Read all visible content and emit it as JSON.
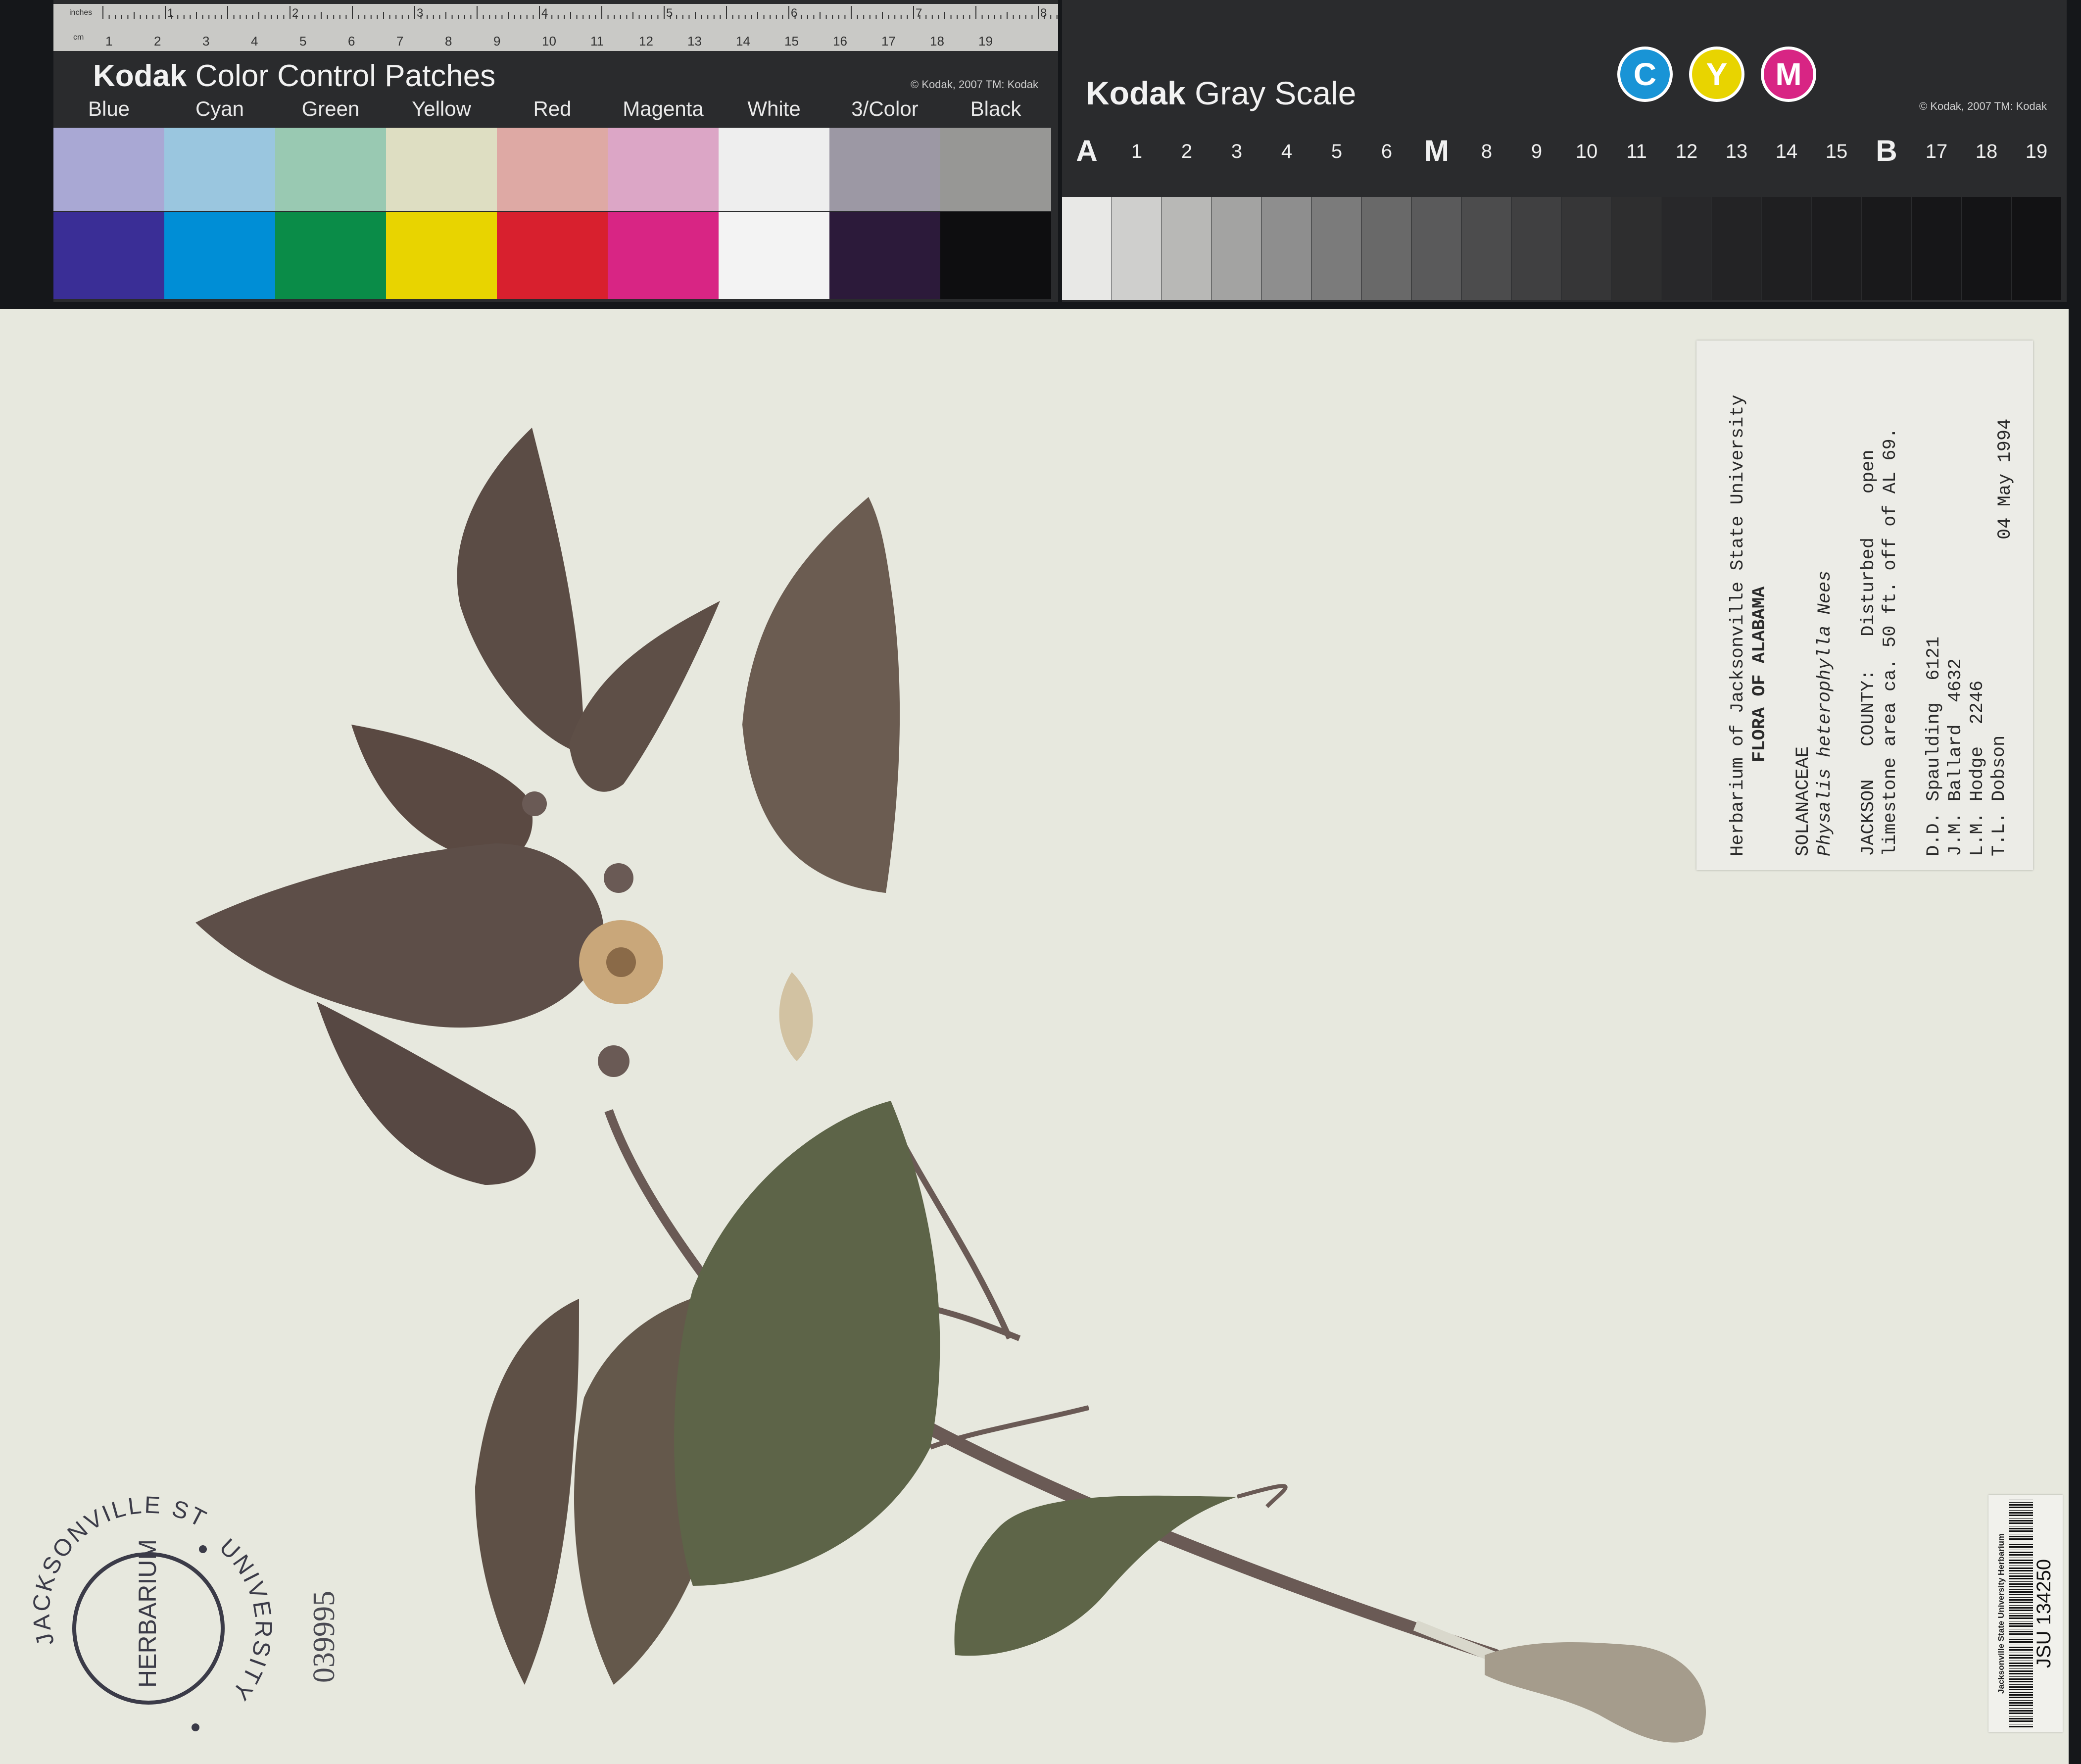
{
  "color_card": {
    "brand": "Kodak",
    "title": "Color Control Patches",
    "copyright": "© Kodak, 2007  TM: Kodak",
    "ruler_units": {
      "inches": "inches",
      "cm": "cm"
    },
    "inch_marks": [
      "1",
      "2",
      "3",
      "4",
      "5",
      "6",
      "7",
      "8"
    ],
    "cm_marks": [
      "1",
      "2",
      "3",
      "4",
      "5",
      "6",
      "7",
      "8",
      "9",
      "10",
      "11",
      "12",
      "13",
      "14",
      "15",
      "16",
      "17",
      "18",
      "19"
    ],
    "patches": [
      {
        "label": "Blue",
        "top": "#a9a8d4",
        "bottom": "#3a2e96"
      },
      {
        "label": "Cyan",
        "top": "#9ac6df",
        "bottom": "#008ed6"
      },
      {
        "label": "Green",
        "top": "#99c9b2",
        "bottom": "#0a8c48"
      },
      {
        "label": "Yellow",
        "top": "#dedec2",
        "bottom": "#e8d400"
      },
      {
        "label": "Red",
        "top": "#dea9a4",
        "bottom": "#d8202e"
      },
      {
        "label": "Magenta",
        "top": "#dca6c6",
        "bottom": "#d82584"
      },
      {
        "label": "White",
        "top": "#eeeeee",
        "bottom": "#f3f3f3"
      },
      {
        "label": "3/Color",
        "top": "#9c98a4",
        "bottom": "#2c1a3a"
      },
      {
        "label": "Black",
        "top": "#979795",
        "bottom": "#0e0e10"
      }
    ]
  },
  "gray_card": {
    "brand": "Kodak",
    "title": "Gray Scale",
    "copyright": "© Kodak, 2007  TM: Kodak",
    "cym": [
      {
        "letter": "C",
        "color": "#1994d6"
      },
      {
        "letter": "Y",
        "color": "#e8d400"
      },
      {
        "letter": "M",
        "color": "#d82584"
      }
    ],
    "steps": [
      "A",
      "1",
      "2",
      "3",
      "4",
      "5",
      "6",
      "M",
      "8",
      "9",
      "10",
      "11",
      "12",
      "13",
      "14",
      "15",
      "B",
      "17",
      "18",
      "19"
    ],
    "grays": [
      "#e8e8e6",
      "#cfcfcd",
      "#b8b8b6",
      "#a3a3a2",
      "#8e8e8e",
      "#7b7b7b",
      "#696969",
      "#5a5a5b",
      "#4c4c4d",
      "#404041",
      "#363637",
      "#2e2e2f",
      "#28282a",
      "#232325",
      "#1f1f21",
      "#1c1c1e",
      "#19191b",
      "#161618",
      "#141416",
      "#121214"
    ]
  },
  "specimen_label": {
    "herbarium": "Herbarium of Jacksonville State University",
    "flora": "FLORA OF ALABAMA",
    "family": "SOLANACEAE",
    "species": "Physalis heterophylla Nees",
    "locality_1": "JACKSON   COUNTY:   Disturbed    open",
    "locality_2": "limestone area ca. 50 ft. off of AL 69.",
    "collector_1": "D.D. Spaulding  6121",
    "collector_2": "J.M. Ballard  4632",
    "collector_3": "L.M. Hodge  2246",
    "collector_4": "T.L. Dobson",
    "date": "04 May 1994"
  },
  "stamp": {
    "top_text": "JACKSONVILLE STATE",
    "right_text": "UNIVERSITY",
    "center_text": "HERBARIUM"
  },
  "accession_number": "039995",
  "barcode": {
    "institution": "Jacksonville State University Herbarium",
    "code": "JSU 134250"
  },
  "colors": {
    "sheet": "#e7e8de",
    "leaf_dark": "#5b4c45",
    "leaf_mid": "#6b5e52",
    "leaf_green": "#5d6448",
    "stem": "#6a5a55",
    "flower": "#c9a77a"
  }
}
